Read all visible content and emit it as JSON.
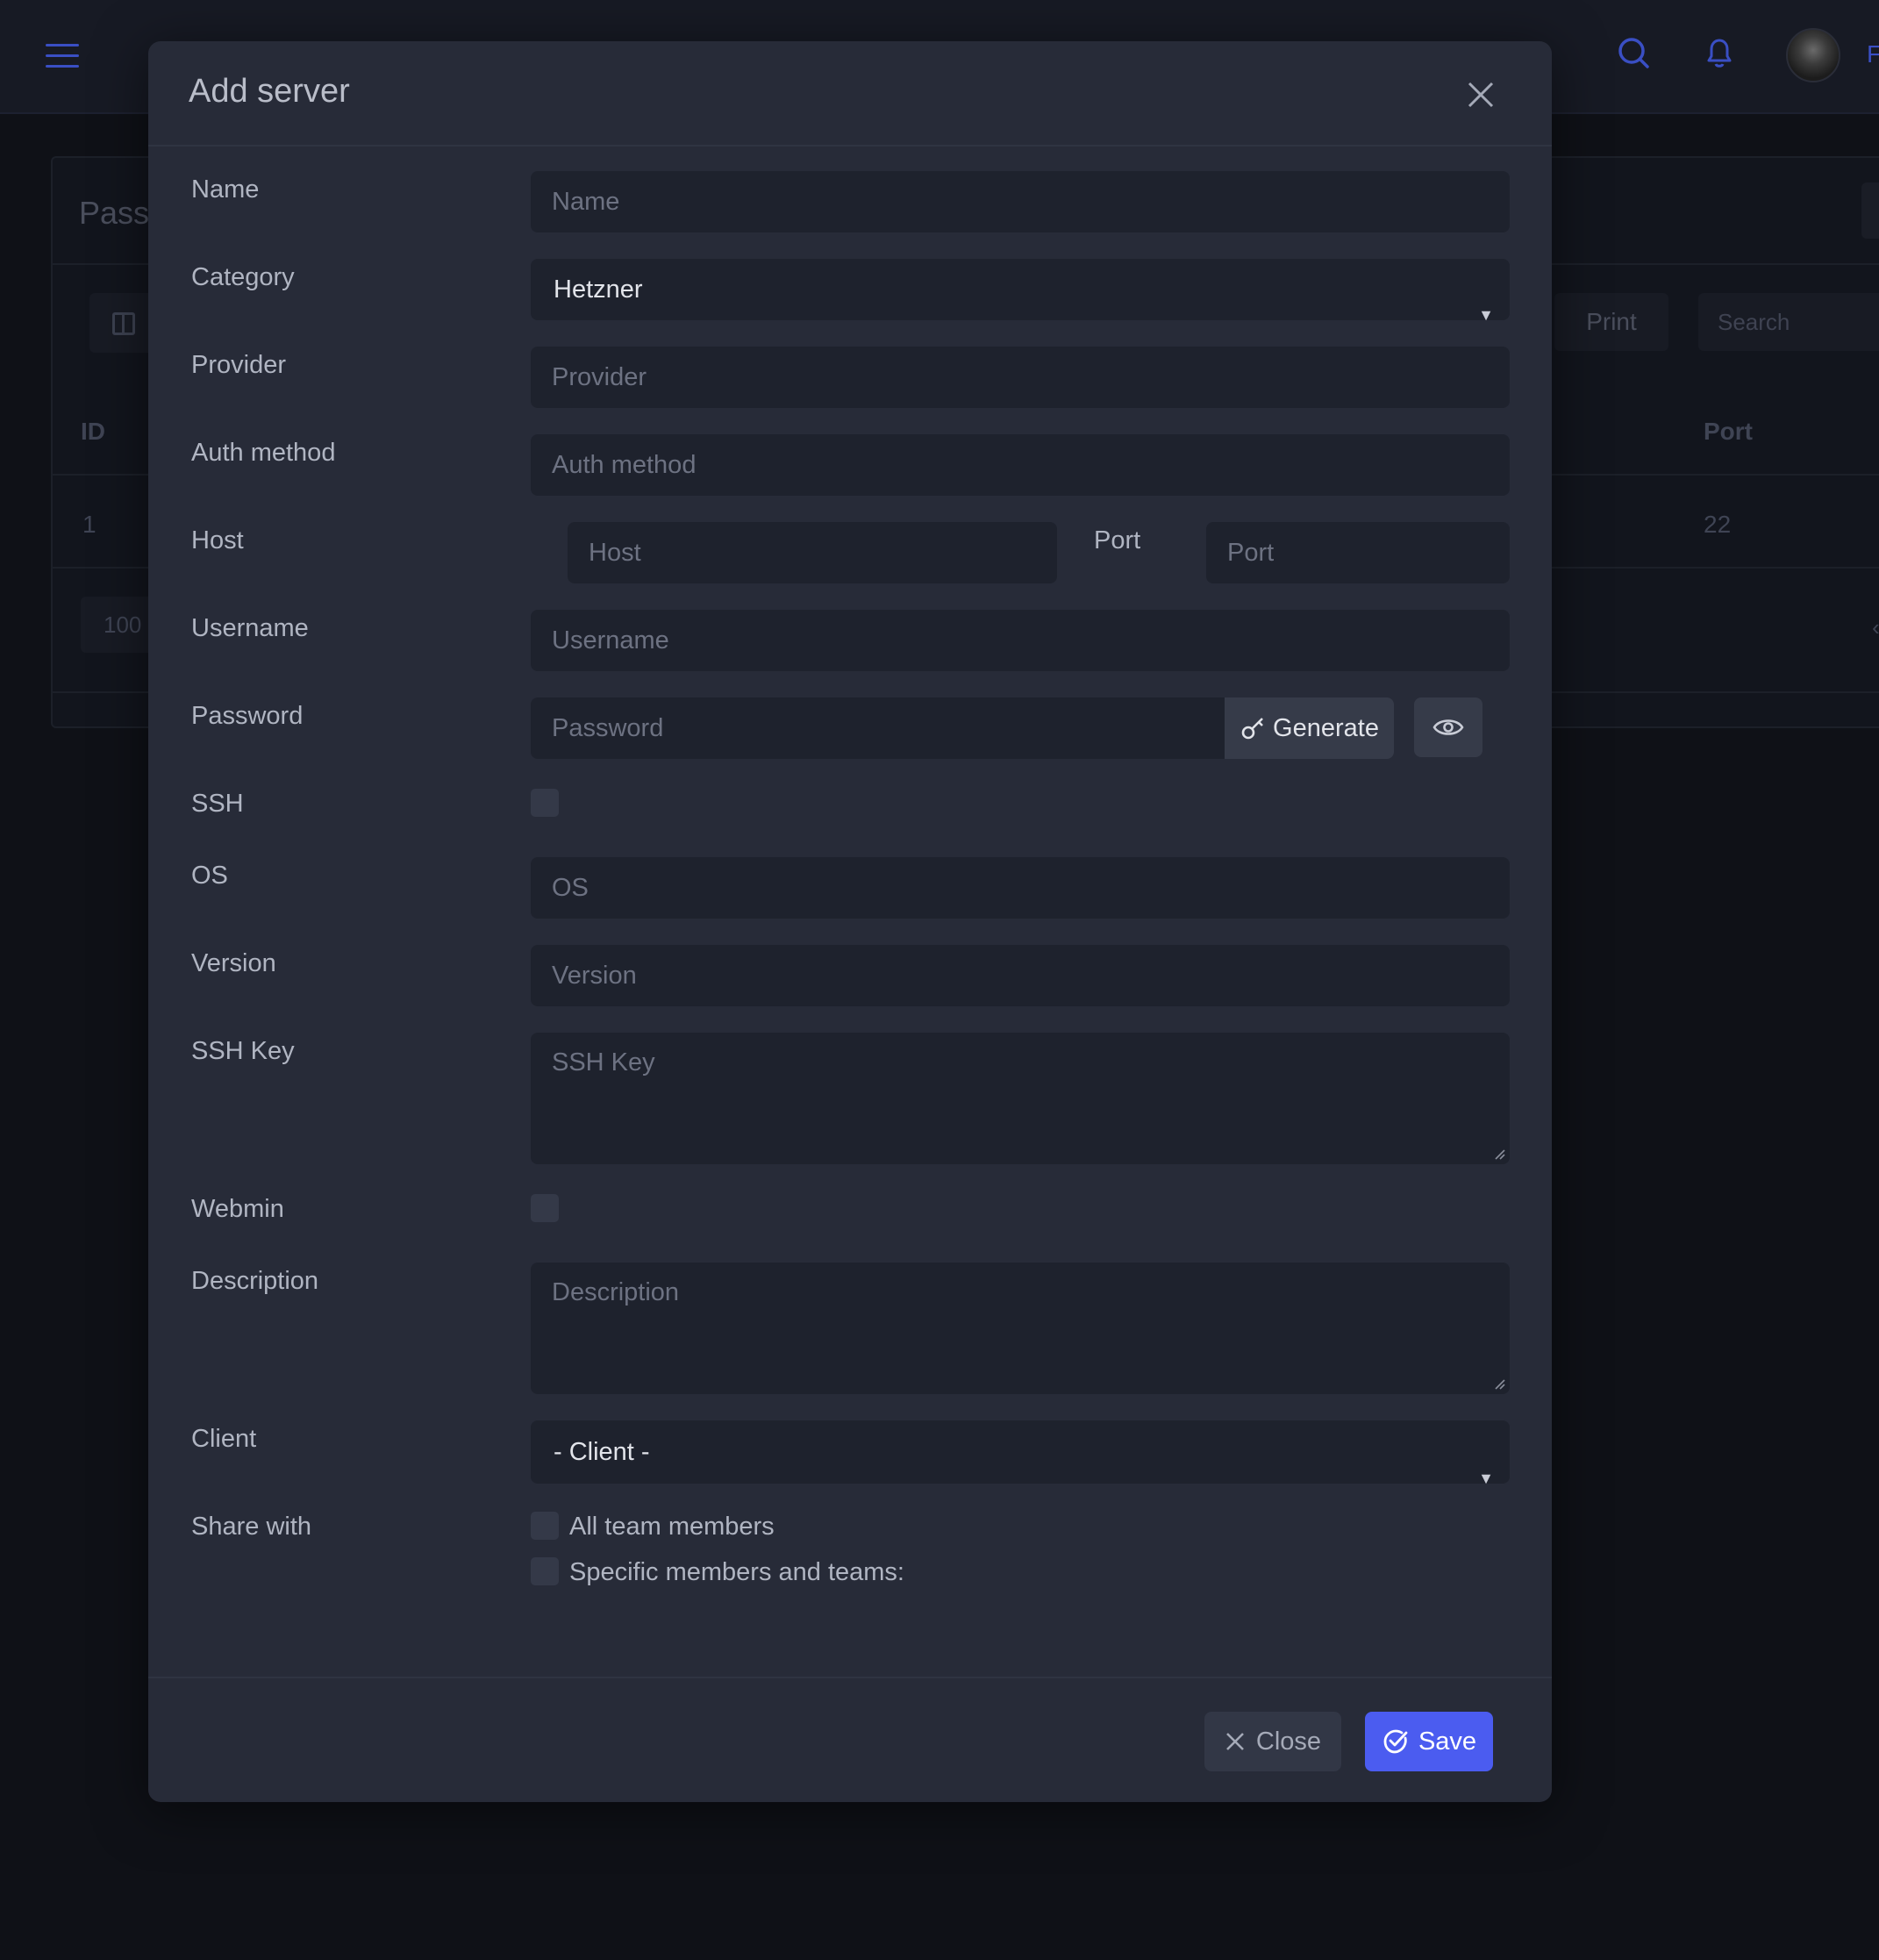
{
  "background": {
    "panel_title": "Pass",
    "toolbar": {
      "print_label": "Print",
      "search_placeholder": "Search"
    },
    "table": {
      "headers": {
        "id": "ID",
        "port": "Port"
      },
      "rows": [
        {
          "id": "1",
          "port": "22"
        }
      ]
    },
    "page_size": "100"
  },
  "modal": {
    "title": "Add server",
    "fields": {
      "name": {
        "label": "Name",
        "placeholder": "Name"
      },
      "category": {
        "label": "Category",
        "value": "Hetzner"
      },
      "provider": {
        "label": "Provider",
        "placeholder": "Provider"
      },
      "auth_method": {
        "label": "Auth method",
        "placeholder": "Auth method"
      },
      "host": {
        "label": "Host",
        "placeholder": "Host"
      },
      "port": {
        "label": "Port",
        "placeholder": "Port"
      },
      "username": {
        "label": "Username",
        "placeholder": "Username"
      },
      "password": {
        "label": "Password",
        "placeholder": "Password",
        "generate_label": "Generate"
      },
      "ssh": {
        "label": "SSH"
      },
      "os": {
        "label": "OS",
        "placeholder": "OS"
      },
      "version": {
        "label": "Version",
        "placeholder": "Version"
      },
      "ssh_key": {
        "label": "SSH Key",
        "placeholder": "SSH Key"
      },
      "webmin": {
        "label": "Webmin"
      },
      "description": {
        "label": "Description",
        "placeholder": "Description"
      },
      "client": {
        "label": "Client",
        "value": "- Client -"
      },
      "share_with": {
        "label": "Share with",
        "options": [
          "All team members",
          "Specific members and teams:"
        ]
      }
    },
    "footer": {
      "close_label": "Close",
      "save_label": "Save"
    }
  },
  "colors": {
    "accent": "#4b5cf0",
    "modal_bg": "#272b38",
    "input_bg": "#1e222d",
    "page_bg": "#0f1117"
  },
  "icons": [
    "hamburger-icon",
    "search-icon",
    "bell-icon",
    "close-icon",
    "key-icon",
    "eye-icon",
    "check-circle-icon",
    "columns-icon"
  ]
}
